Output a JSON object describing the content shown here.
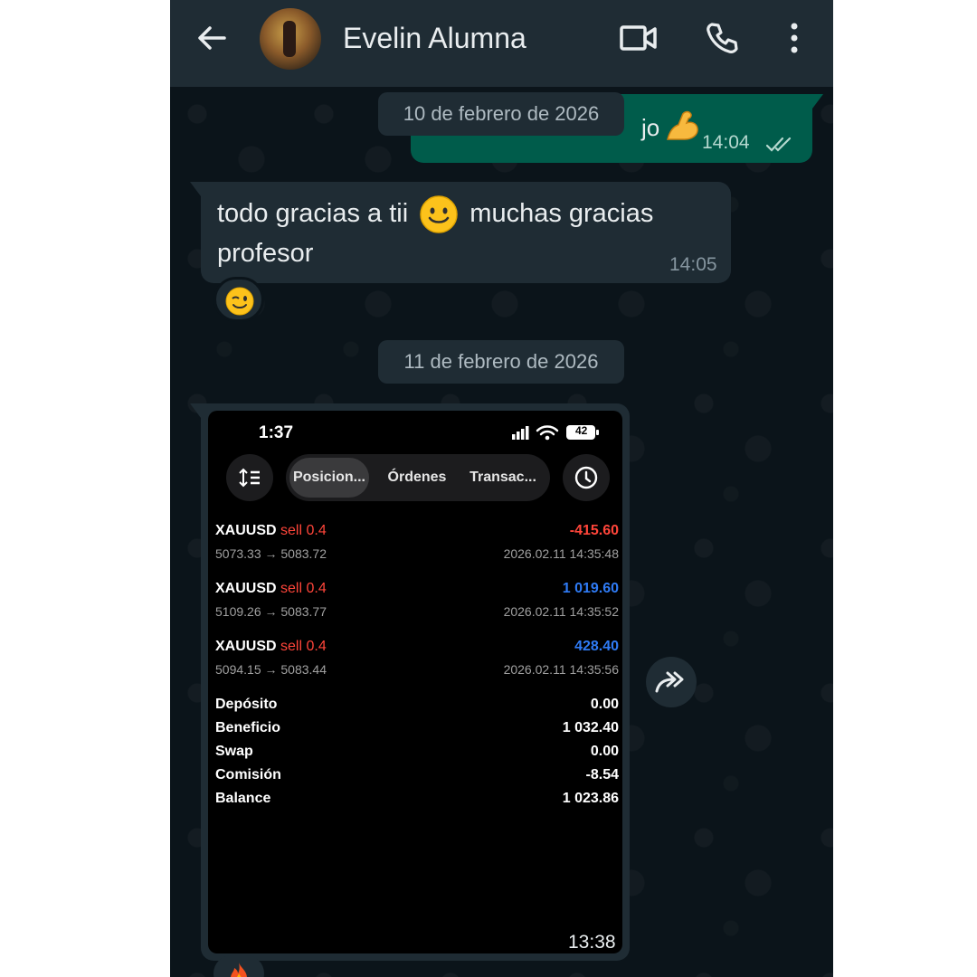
{
  "header": {
    "contact_name": "Evelin Alumna",
    "icons": [
      "back-arrow-icon",
      "video-call-icon",
      "phone-icon",
      "more-vertical-icon"
    ]
  },
  "messages": {
    "outgoing_partial": {
      "visible_text": "jo",
      "emoji": "flexed-biceps",
      "time": "14:04",
      "status": "read"
    },
    "date_separator_1": "10 de febrero de 2026",
    "incoming_1": {
      "text_before_emoji": "todo gracias a tii",
      "emoji": "smiling-face",
      "text_after_emoji": "muchas gracias profesor",
      "time": "14:05",
      "reaction": "winking-face"
    },
    "date_separator_2": "11 de febrero de 2026",
    "incoming_image": {
      "time": "13:38",
      "reaction": "fire"
    }
  },
  "screenshot": {
    "status_time": "1:37",
    "battery": "42",
    "tabs": [
      {
        "label": "Posicion...",
        "active": true
      },
      {
        "label": "Órdenes",
        "active": false
      },
      {
        "label": "Transac...",
        "active": false
      }
    ],
    "positions": [
      {
        "symbol": "XAUUSD",
        "direction": "sell 0.4",
        "profit": "-415.60",
        "profit_color": "#ff453a",
        "prices": "5073.33 → 5083.72",
        "datetime": "2026.02.11 14:35:48"
      },
      {
        "symbol": "XAUUSD",
        "direction": "sell 0.4",
        "profit": "1 019.60",
        "profit_color": "#2f7bf5",
        "prices": "5109.26 → 5083.77",
        "datetime": "2026.02.11 14:35:52"
      },
      {
        "symbol": "XAUUSD",
        "direction": "sell 0.4",
        "profit": "428.40",
        "profit_color": "#2f7bf5",
        "prices": "5094.15 → 5083.44",
        "datetime": "2026.02.11 14:35:56"
      }
    ],
    "summary": [
      {
        "label": "Depósito",
        "value": "0.00"
      },
      {
        "label": "Beneficio",
        "value": "1 032.40"
      },
      {
        "label": "Swap",
        "value": "0.00"
      },
      {
        "label": "Comisión",
        "value": "-8.54"
      },
      {
        "label": "Balance",
        "value": "1 023.86"
      }
    ]
  },
  "colors": {
    "chat_bg": "#0b141a",
    "header_bg": "#1f2c34",
    "outgoing_bubble": "#005c4b",
    "incoming_bubble": "#1f2c34",
    "loss": "#ff453a",
    "profit": "#2f7bf5"
  }
}
